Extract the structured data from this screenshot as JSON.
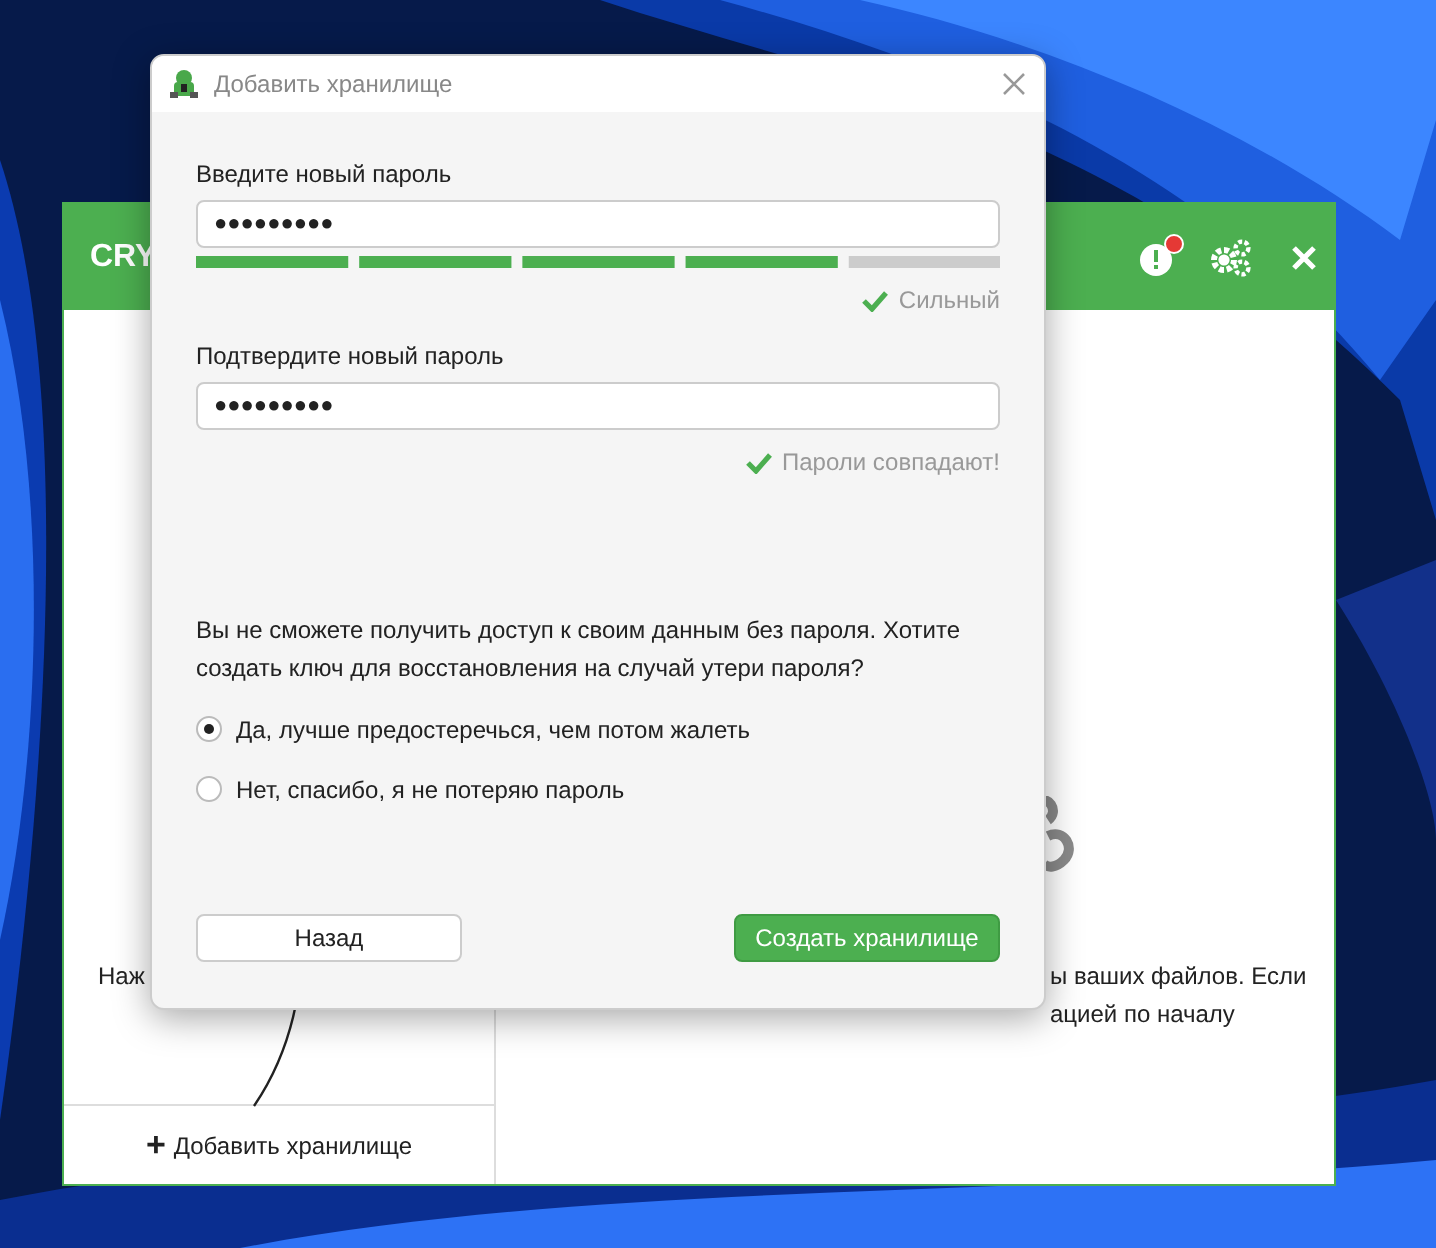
{
  "main_window": {
    "title": "CRY",
    "header_icons": [
      {
        "kind": "alert",
        "badge": true
      },
      {
        "kind": "settings",
        "badge": false
      },
      {
        "kind": "close",
        "badge": false
      }
    ],
    "sidebar": {
      "hint": "Наж",
      "add_button": {
        "icon": "+",
        "label": "Добавить хранилище"
      }
    },
    "content": {
      "lines": [
        "ы ваших файлов. Если",
        "ацией по началу"
      ]
    }
  },
  "dialog": {
    "title": "Добавить хранилище",
    "new_password": {
      "label": "Введите новый пароль",
      "value": "●●●●●●●●●",
      "level": 0.8,
      "strength": "Сильный"
    },
    "confirm_password": {
      "label": "Подтвердите новый пароль",
      "value": "●●●●●●●●●",
      "match": "Пароли совпадают!"
    },
    "question": "Вы не сможете получить доступ к своим данным без пароля. Хотите создать ключ для восстановления на случай утери пароля?",
    "options": [
      {
        "label": "Да, лучше предостеречься, чем потом жалеть",
        "selected": true
      },
      {
        "label": "Нет, спасибо, я не потеряю пароль",
        "selected": false
      }
    ],
    "buttons": [
      {
        "label": "Назад",
        "kind": "secondary"
      },
      {
        "label": "Создать хранилище",
        "kind": "primary"
      }
    ]
  }
}
